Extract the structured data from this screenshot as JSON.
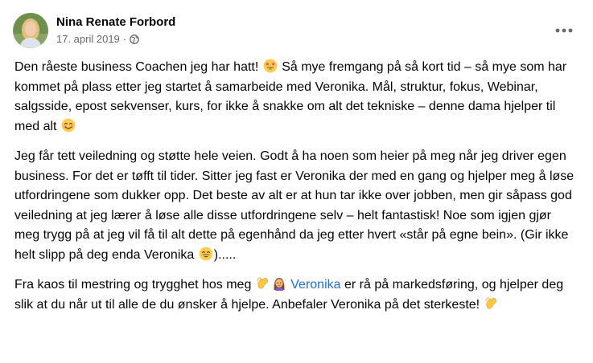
{
  "post": {
    "author": "Nina Renate Forbord",
    "date": "17. april 2019",
    "separator": "·",
    "privacy_icon": "globe-icon",
    "menu_icon": "more-horizontal-icon",
    "paragraphs": {
      "p1": {
        "a": "Den råeste business Coachen jeg har hatt!",
        "b": "Så mye fremgang på så kort tid – så mye som har kommet på plass etter jeg startet å samarbeide med Veronika. Mål, struktur, fokus, Webinar, salgsside, epost sekvenser, kurs, for ikke å snakke om alt det tekniske – denne dama hjelper til med alt"
      },
      "p2": {
        "a": "Jeg får tett veiledning og støtte hele veien. Godt å ha noen som heier på meg når jeg driver egen business. For det er tøfft til tider. Sitter jeg fast er Veronika der med en gang og hjelper meg å løse utfordringene som dukker opp. Det beste av alt er at hun tar ikke over jobben, men gir såpass god veiledning at jeg lærer å løse alle disse utfordringene selv – helt fantastisk! Noe som igjen gjør meg trygg på at jeg vil få til alt dette på egenhånd da jeg etter hvert «står på egne bein». (Gir ikke helt slipp på deg enda Veronika",
        "b": ")....."
      },
      "p3": {
        "a": "Fra kaos til mestring og trygghet hos meg",
        "mention": "Veronika",
        "b": "er rå på markedsføring, og hjelper deg slik at du når ut til alle de du ønsker å hjelpe. Anbefaler Veronika på det sterkeste!"
      }
    },
    "colors": {
      "text": "#050505",
      "secondary": "#65676b",
      "link": "#216fdb",
      "background": "#ffffff"
    }
  }
}
